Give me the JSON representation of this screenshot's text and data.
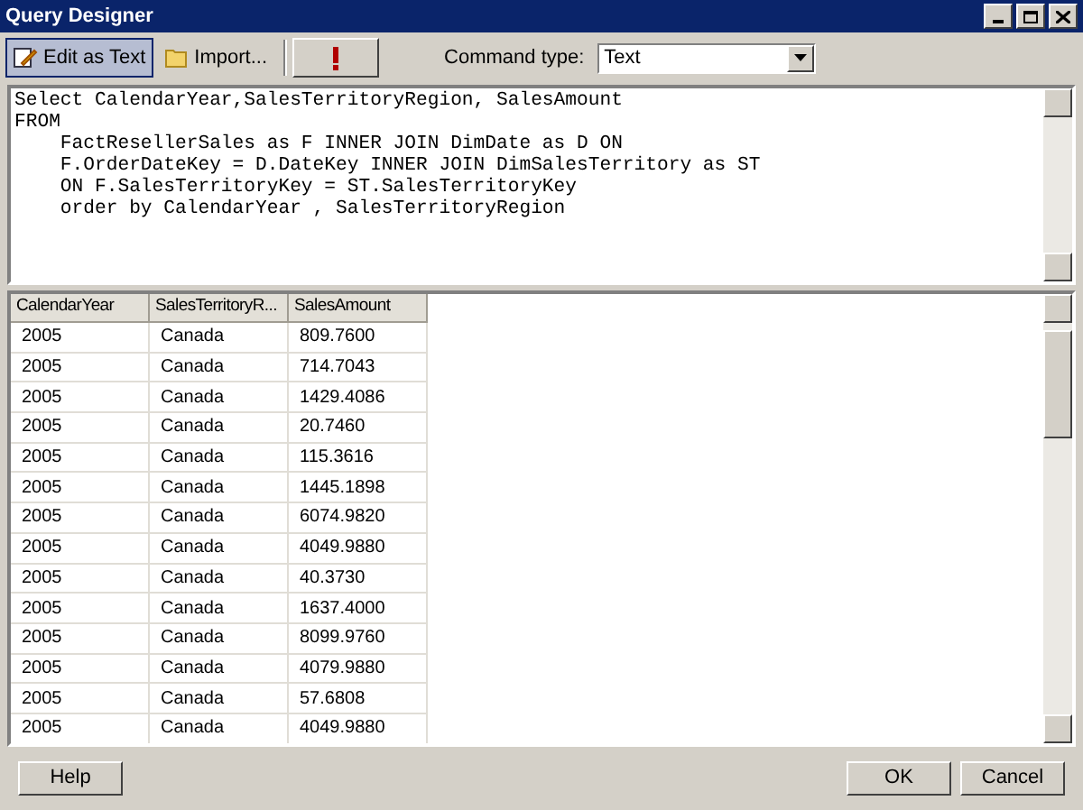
{
  "window": {
    "title": "Query Designer"
  },
  "toolbar": {
    "buttons": [
      {
        "kind": "edit",
        "label": "Edit as Text",
        "selected": true
      },
      {
        "kind": "import",
        "label": "Import...",
        "selected": false
      },
      {
        "kind": "run",
        "selected": false
      }
    ],
    "command_type": {
      "label": "Command type:",
      "value": "Text"
    }
  },
  "query": [
    "Select CalendarYear,SalesTerritoryRegion, SalesAmount",
    "FROM",
    "    FactResellerSales as F INNER JOIN DimDate as D ON",
    "    F.OrderDateKey = D.DateKey INNER JOIN DimSalesTerritory as ST",
    "    ON F.SalesTerritoryKey = ST.SalesTerritoryKey",
    "    order by CalendarYear , SalesTerritoryRegion"
  ],
  "table": {
    "columns": [
      "CalendarYear",
      "SalesTerritoryR...",
      "SalesAmount"
    ],
    "rows": [
      [
        "2005",
        "Canada",
        "809.7600"
      ],
      [
        "2005",
        "Canada",
        "714.7043"
      ],
      [
        "2005",
        "Canada",
        "1429.4086"
      ],
      [
        "2005",
        "Canada",
        "20.7460"
      ],
      [
        "2005",
        "Canada",
        "115.3616"
      ],
      [
        "2005",
        "Canada",
        "1445.1898"
      ],
      [
        "2005",
        "Canada",
        "6074.9820"
      ],
      [
        "2005",
        "Canada",
        "4049.9880"
      ],
      [
        "2005",
        "Canada",
        "40.3730"
      ],
      [
        "2005",
        "Canada",
        "1637.4000"
      ],
      [
        "2005",
        "Canada",
        "8099.9760"
      ],
      [
        "2005",
        "Canada",
        "4079.9880"
      ],
      [
        "2005",
        "Canada",
        "57.6808"
      ],
      [
        "2005",
        "Canada",
        "4049.9880"
      ]
    ]
  },
  "footer": {
    "help": "Help",
    "ok": "OK",
    "cancel": "Cancel"
  }
}
